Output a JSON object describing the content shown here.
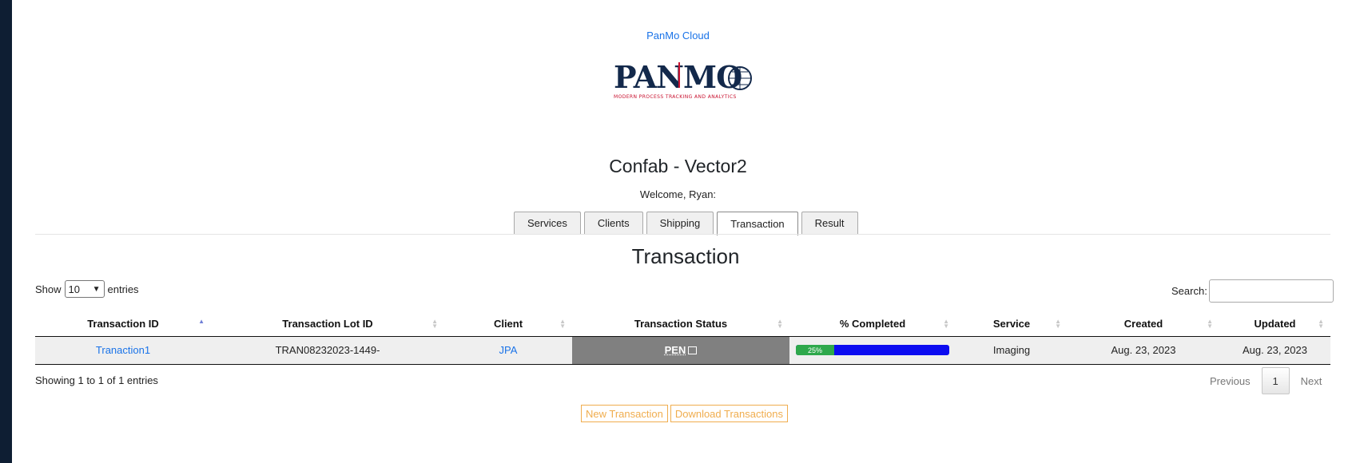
{
  "header": {
    "top_link": "PanMo Cloud",
    "logo_text": "PANMO",
    "logo_tagline": "MODERN PROCESS TRACKING AND ANALYTICS",
    "title": "Confab - Vector2",
    "welcome": "Welcome, Ryan:"
  },
  "tabs": [
    {
      "label": "Services",
      "active": false
    },
    {
      "label": "Clients",
      "active": false
    },
    {
      "label": "Shipping",
      "active": false
    },
    {
      "label": "Transaction",
      "active": true
    },
    {
      "label": "Result",
      "active": false
    }
  ],
  "section": {
    "title": "Transaction"
  },
  "table_controls": {
    "show_label": "Show",
    "entries_value": "10",
    "entries_label": "entries",
    "search_label": "Search:"
  },
  "table": {
    "columns": [
      "Transaction ID",
      "Transaction Lot ID",
      "Client",
      "Transaction Status",
      "% Completed",
      "Service",
      "Created",
      "Updated"
    ],
    "rows": [
      {
        "transaction_id": "Tranaction1",
        "lot_id": "TRAN08232023-1449-",
        "client": "JPA",
        "status": "PEN",
        "completed_label": "25%",
        "completed_fraction": 0.25,
        "service": "Imaging",
        "created": "Aug. 23, 2023",
        "updated": "Aug. 23, 2023"
      }
    ]
  },
  "footer": {
    "info": "Showing 1 to 1 of 1 entries",
    "previous": "Previous",
    "page": "1",
    "next": "Next"
  },
  "actions": {
    "new_transaction": "New Transaction",
    "download": "Download Transactions"
  },
  "colors": {
    "sidebar": "#0e1e33",
    "link": "#1a73e8",
    "status_bg": "#808080",
    "progress_fill": "#2ea84b",
    "progress_track": "#0b0bf0",
    "action_border": "#f0ad4e"
  }
}
